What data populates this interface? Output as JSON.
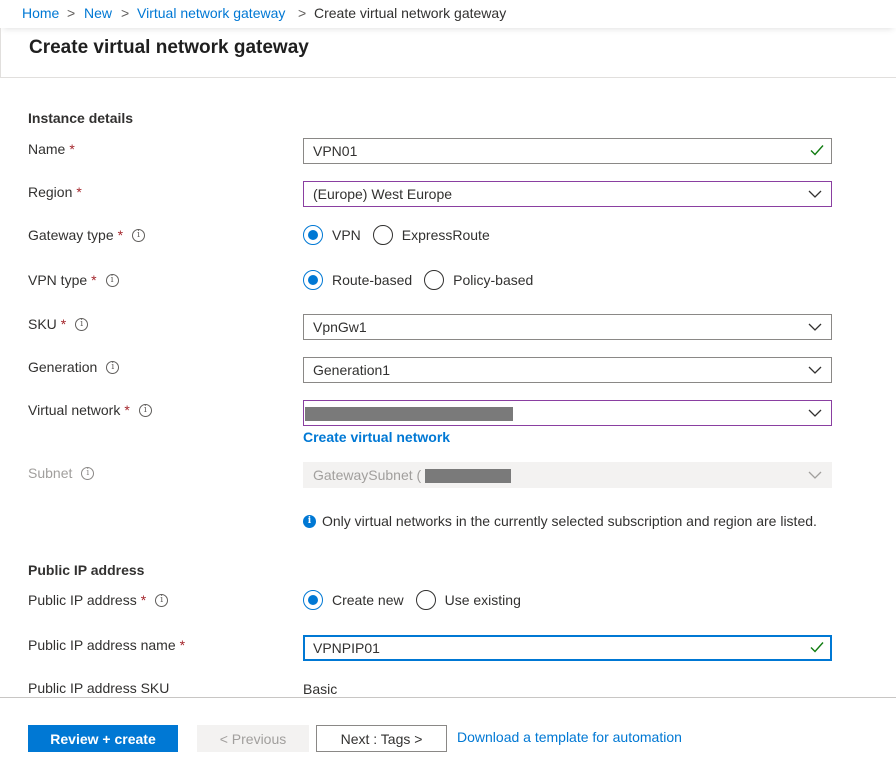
{
  "breadcrumb": {
    "items": [
      "Home",
      "New",
      "Virtual network gateway",
      "Create virtual network gateway"
    ],
    "separator": ">"
  },
  "page": {
    "title": "Create virtual network gateway"
  },
  "instance": {
    "section_title": "Instance details",
    "name": {
      "label": "Name",
      "value": "VPN01",
      "required": "*"
    },
    "region": {
      "label": "Region",
      "value": "(Europe) West Europe",
      "required": "*"
    },
    "gateway_type": {
      "label": "Gateway type",
      "required": "*",
      "options": [
        "VPN",
        "ExpressRoute"
      ],
      "selected": "VPN"
    },
    "vpn_type": {
      "label": "VPN type",
      "required": "*",
      "options": [
        "Route-based",
        "Policy-based"
      ],
      "selected": "Route-based"
    },
    "sku": {
      "label": "SKU",
      "value": "VpnGw1",
      "required": "*"
    },
    "generation": {
      "label": "Generation",
      "value": "Generation1"
    },
    "virtual_network": {
      "label": "Virtual network",
      "required": "*",
      "create_link": "Create virtual network"
    },
    "subnet": {
      "label": "Subnet",
      "value": "GatewaySubnet ("
    },
    "info_note": "Only virtual networks in the currently selected subscription and region are listed."
  },
  "public_ip": {
    "section_title": "Public IP address",
    "address": {
      "label": "Public IP address",
      "required": "*",
      "options": [
        "Create new",
        "Use existing"
      ],
      "selected": "Create new"
    },
    "name": {
      "label": "Public IP address name",
      "required": "*",
      "value": "VPNPIP01"
    },
    "sku": {
      "label": "Public IP address SKU",
      "value": "Basic"
    }
  },
  "footer": {
    "review_create": "Review + create",
    "previous": "< Previous",
    "next": "Next : Tags >",
    "download_link": "Download a template for automation"
  },
  "colors": {
    "accent": "#0078d4",
    "required": "#a4262c",
    "invalid_border": "#8a3fa1",
    "valid_check": "#107c10"
  },
  "icons": [
    "chevron-right-icon",
    "info-icon",
    "checkmark-icon",
    "chevron-down-icon",
    "info-filled-icon"
  ]
}
